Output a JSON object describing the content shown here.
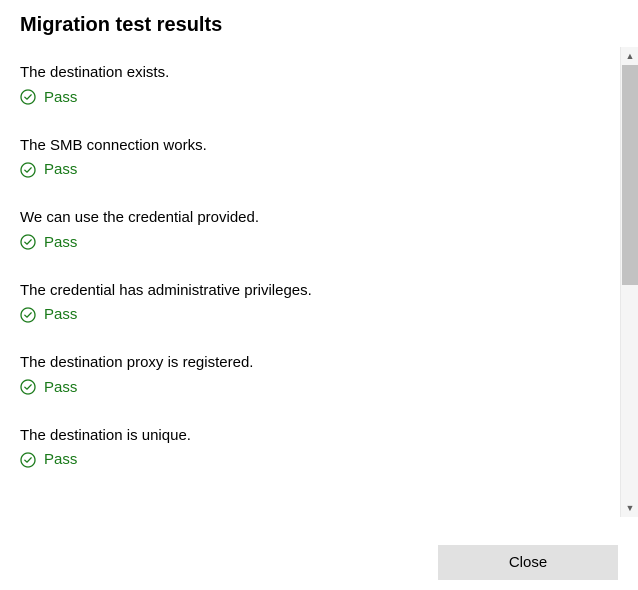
{
  "title": "Migration test results",
  "results": [
    {
      "description": "The destination exists.",
      "status": "Pass"
    },
    {
      "description": "The SMB connection works.",
      "status": "Pass"
    },
    {
      "description": "We can use the credential provided.",
      "status": "Pass"
    },
    {
      "description": "The credential has administrative privileges.",
      "status": "Pass"
    },
    {
      "description": "The destination proxy is registered.",
      "status": "Pass"
    },
    {
      "description": "The destination is unique.",
      "status": "Pass"
    }
  ],
  "footer": {
    "close_label": "Close"
  },
  "colors": {
    "pass": "#1a7a1a"
  }
}
